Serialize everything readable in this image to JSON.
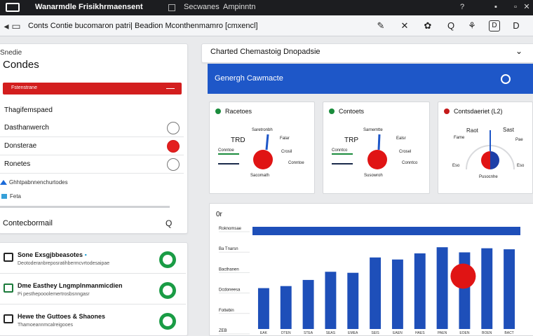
{
  "titlebar": {
    "title": "Wanarmdle Frisikhrmaensent",
    "link_1": "Secwanes",
    "link_2": "Ampinntn"
  },
  "urlbar": {
    "url_text": "Conts Contie bucomaron patri| Beadion Mconthenmamro [cmxencl]",
    "tool_1": "✎",
    "tool_2": "✕",
    "tool_3": "✿",
    "tool_4": "Q",
    "tool_5": "⚘",
    "tool_6": "D",
    "tool_7": "D"
  },
  "left_panel": {
    "small_label": "Snedie",
    "title": "Condes",
    "red_bar_text": "Fstenstrane",
    "section_header": "Thagifemspaed",
    "options": [
      {
        "label": "Dasthanwerch",
        "selected": false
      },
      {
        "label": "Donsterae",
        "selected": true
      },
      {
        "label": "Ronetes",
        "selected": false
      }
    ],
    "info_1": "Ghhtpabnnenchurtodes",
    "info_2": "Feta",
    "search_label": "Contecbormail"
  },
  "list": [
    {
      "title": "Sone Exsgjbbeasotes",
      "subtitle": "Deotoderanbreposratihbermcvrtodesaipae",
      "icon": "window-icon"
    },
    {
      "title": "Dme Easthey Lngmplnmanmicdien",
      "subtitle": "Pi pesthepooolemertrosbsnngasr",
      "icon": "grid-icon"
    },
    {
      "title": "Hewe the Guttoes & Shaones",
      "subtitle": "Thamoeannmcalreigooes",
      "icon": "monitor-icon"
    }
  ],
  "dashboard": {
    "title": "Charted Chemastoig Dnopadsie",
    "banner_text": "Genergh Cawmacte",
    "gauges": [
      {
        "title": "Racetoes",
        "caption_top": "Saretronbh",
        "value": "TRD",
        "caption_right": "Falar",
        "caption_right2": "Crosil",
        "caption_bottom": "Sacomath",
        "legend": "Conntoe",
        "accent": "#1a8c3c"
      },
      {
        "title": "Contoets",
        "caption_top": "Sarnemtte",
        "value": "TRP",
        "caption_right": "Ealsr",
        "caption_right2": "Crosel",
        "caption_bottom": "Susowroh",
        "legend": "Conntco",
        "accent": "#1a8c3c"
      },
      {
        "title": "Contsdaeriet (L2)",
        "caption_top": "Raot",
        "value": "Sast",
        "caption_right": "Fame",
        "caption_right2": "Pae",
        "caption_bottom": "Pusocnhe",
        "legend": "Eso",
        "accent": "#c41a1a"
      }
    ],
    "chart_title": "0r"
  },
  "chart_data": {
    "type": "bar",
    "categories": [
      "EAK",
      "DTEN",
      "STEA",
      "SEAS",
      "EMEA",
      "SEIS",
      "EAEN",
      "HAES",
      "PAEN",
      "EOEN",
      "BOEN",
      "BACT"
    ],
    "values": [
      40,
      42,
      48,
      56,
      55,
      70,
      68,
      74,
      80,
      75,
      79,
      78
    ],
    "ylim": [
      0,
      100
    ],
    "ytick_labels": [
      "Roknomsae",
      "Ba Tnarsn",
      "Bacthanen",
      "Dcdoneesa",
      "Fottebin",
      "ZEB"
    ],
    "colors": {
      "bar": "#1e4fb9",
      "top_band": "#1e4fb9",
      "marker": "#e01414"
    },
    "marker_category_index": 9
  }
}
